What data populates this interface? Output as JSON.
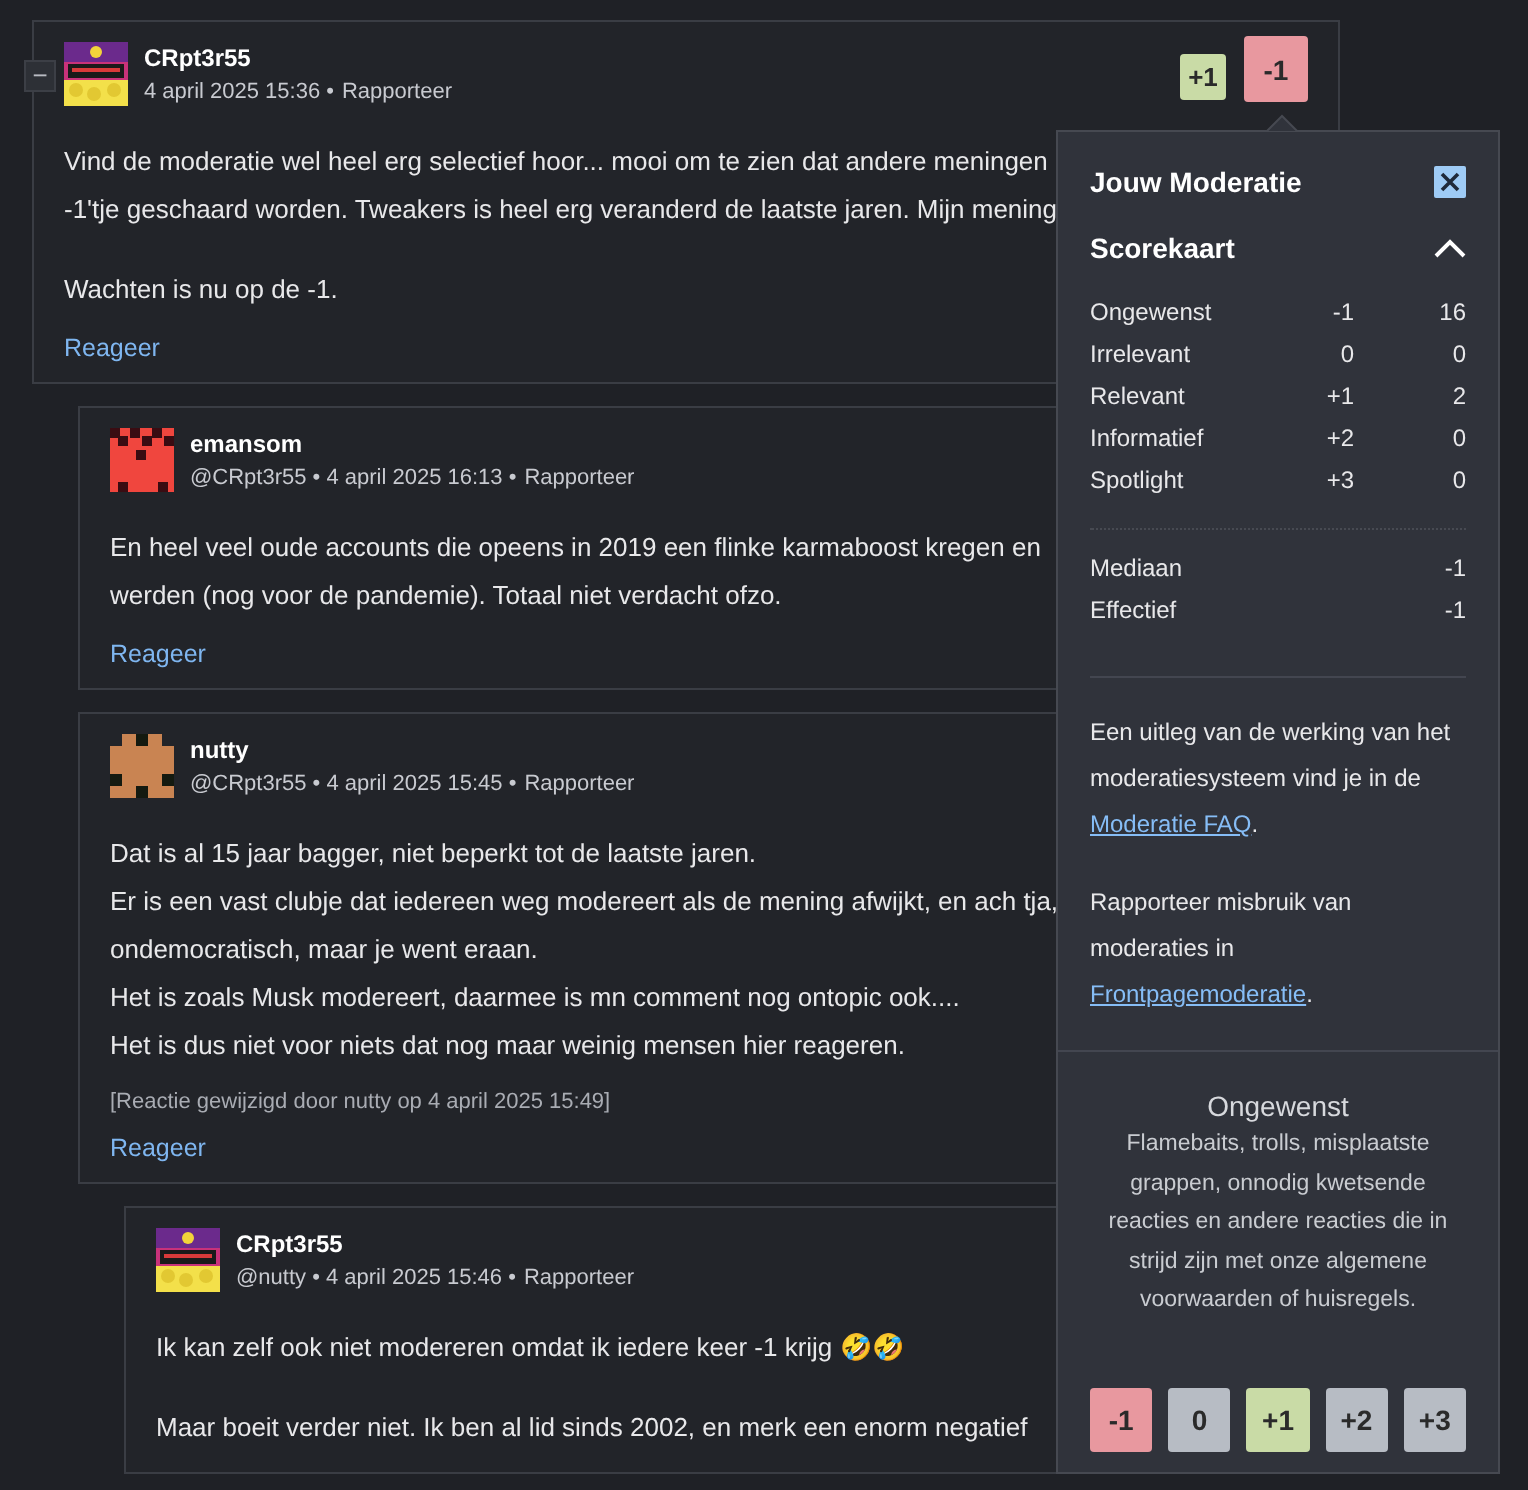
{
  "thread": {
    "collapse_label": "−",
    "comments": [
      {
        "author": "CRpt3r55",
        "avatar": {
          "kind": "picture"
        },
        "meta": "4 april 2025 15:36 •",
        "report": "Rapporteer",
        "votes": [
          {
            "label": "+1",
            "color": "#c9dba6",
            "selected": false
          },
          {
            "label": "-1",
            "color": "#e8989f",
            "selected": true
          }
        ],
        "paragraphs": [
          [
            "Vind de moderatie wel heel erg selectief hoor... mooi om te zien dat andere meningen",
            "-1'tje geschaard worden. Tweakers is heel erg veranderd de laatste jaren. Mijn mening"
          ],
          [
            "Wachten is nu op de -1."
          ]
        ],
        "reply": "Reageer",
        "children": [
          {
            "author": "emansom",
            "avatar": {
              "kind": "invader",
              "color": "#f0463e"
            },
            "meta": "@CRpt3r55 • 4 april 2025 16:13 •",
            "report": "Rapporteer",
            "paragraphs": [
              [
                "En heel veel oude accounts die opeens in 2019 een flinke karmaboost kregen en",
                "werden (nog voor de pandemie). Totaal niet verdacht ofzo."
              ]
            ],
            "reply": "Reageer"
          },
          {
            "author": "nutty",
            "avatar": {
              "kind": "blocks",
              "color": "#c98452"
            },
            "meta": "@CRpt3r55 • 4 april 2025 15:45 •",
            "report": "Rapporteer",
            "paragraphs": [
              [
                "Dat is al 15 jaar bagger, niet beperkt tot de laatste jaren.",
                "Er is een vast clubje dat iedereen weg modereert als de mening afwijkt, en ach tja,",
                "ondemocratisch, maar je went eraan.",
                "Het is zoals Musk modereert, daarmee is mn comment nog ontopic ook....",
                "Het is dus niet voor niets dat nog maar weinig mensen hier reageren."
              ]
            ],
            "edit_note": "[Reactie gewijzigd door nutty op 4 april 2025 15:49]",
            "reply": "Reageer",
            "children": [
              {
                "author": "CRpt3r55",
                "avatar": {
                  "kind": "picture"
                },
                "meta": "@nutty • 4 april 2025 15:46 •",
                "report": "Rapporteer",
                "paragraphs": [
                  [
                    "Ik kan zelf ook niet modereren omdat ik iedere keer -1 krijg 🤣🤣"
                  ],
                  [
                    "Maar boeit verder niet. Ik ben al lid sinds 2002, en merk een enorm negatief"
                  ]
                ]
              }
            ]
          }
        ]
      }
    ]
  },
  "moderation_popup": {
    "title": "Jouw Moderatie",
    "scorecard": {
      "title": "Scorekaart",
      "expanded": true,
      "rows": [
        {
          "label": "Ongewenst",
          "score": "-1",
          "count": "16"
        },
        {
          "label": "Irrelevant",
          "score": "0",
          "count": "0"
        },
        {
          "label": "Relevant",
          "score": "+1",
          "count": "2"
        },
        {
          "label": "Informatief",
          "score": "+2",
          "count": "0"
        },
        {
          "label": "Spotlight",
          "score": "+3",
          "count": "0"
        }
      ],
      "summary": [
        {
          "label": "Mediaan",
          "value": "-1"
        },
        {
          "label": "Effectief",
          "value": "-1"
        }
      ]
    },
    "info": [
      {
        "text": "Een uitleg van de werking van het moderatiesysteem vind je in de",
        "link": "Moderatie FAQ",
        "after": "."
      },
      {
        "text": "Rapporteer misbruik van moderaties in",
        "link": "Frontpagemoderatie",
        "after": "."
      }
    ],
    "category": {
      "title": "Ongewenst",
      "description": "Flamebaits, trolls, misplaatste grappen, onnodig kwetsende reacties en andere reacties die in strijd zijn met onze algemene voorwaarden of huisregels."
    },
    "buttons": [
      {
        "label": "-1",
        "color": "#e8989f"
      },
      {
        "label": "0",
        "color": "#b7bcc4"
      },
      {
        "label": "+1",
        "color": "#c9dba6"
      },
      {
        "label": "+2",
        "color": "#b7bcc4"
      },
      {
        "label": "+3",
        "color": "#b7bcc4"
      }
    ]
  }
}
